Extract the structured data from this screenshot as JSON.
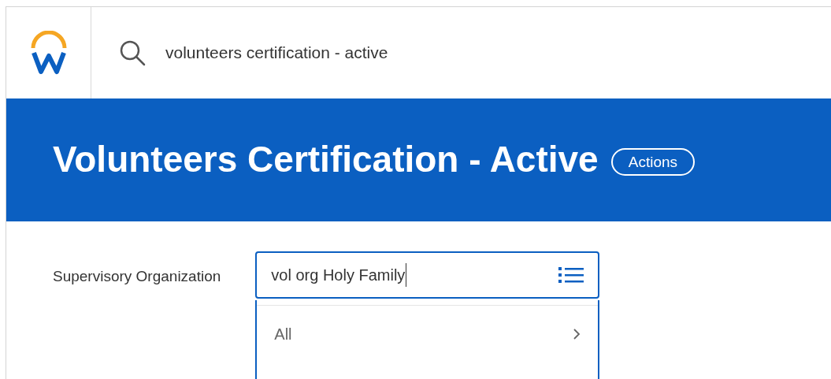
{
  "header": {
    "search": {
      "value": "volunteers certification - active"
    }
  },
  "banner": {
    "title": "Volunteers Certification - Active",
    "actions_button": "Actions"
  },
  "form": {
    "label": "Supervisory Organization",
    "value": "vol org Holy Family",
    "options": [
      {
        "label": "All"
      }
    ]
  }
}
